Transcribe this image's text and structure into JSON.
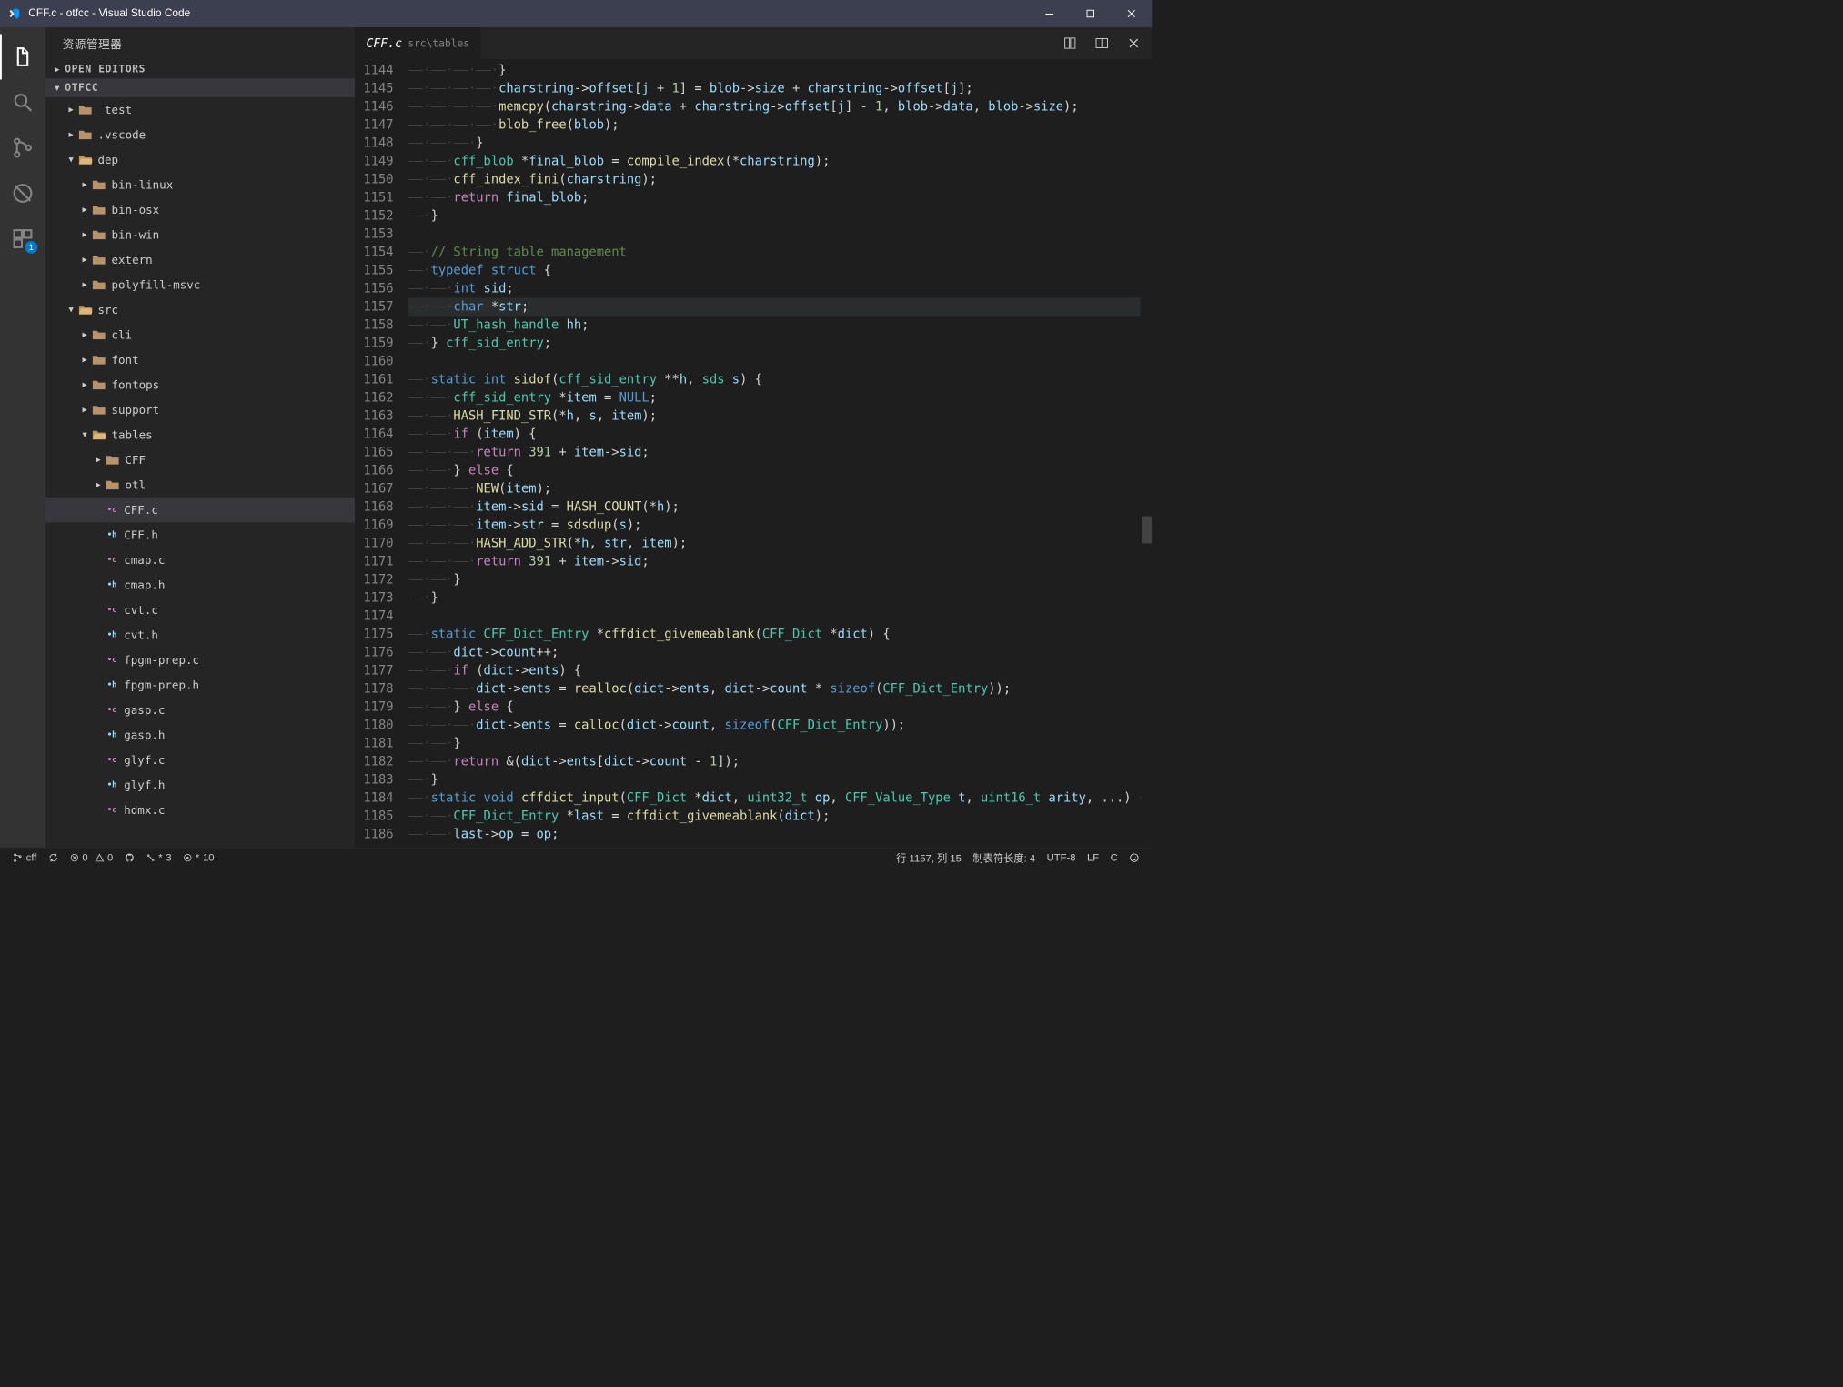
{
  "window": {
    "title": "CFF.c - otfcc - Visual Studio Code"
  },
  "sidebar": {
    "title": "资源管理器",
    "sections": {
      "openEditors": "OPEN EDITORS",
      "project": "OTFCC"
    },
    "tree": [
      {
        "depth": 0,
        "type": "folder",
        "name": "_test",
        "expanded": false
      },
      {
        "depth": 0,
        "type": "folder",
        "name": ".vscode",
        "expanded": false
      },
      {
        "depth": 0,
        "type": "folder",
        "name": "dep",
        "expanded": true
      },
      {
        "depth": 1,
        "type": "folder",
        "name": "bin-linux",
        "expanded": false
      },
      {
        "depth": 1,
        "type": "folder",
        "name": "bin-osx",
        "expanded": false
      },
      {
        "depth": 1,
        "type": "folder",
        "name": "bin-win",
        "expanded": false
      },
      {
        "depth": 1,
        "type": "folder",
        "name": "extern",
        "expanded": false
      },
      {
        "depth": 1,
        "type": "folder",
        "name": "polyfill-msvc",
        "expanded": false
      },
      {
        "depth": 0,
        "type": "folder",
        "name": "src",
        "expanded": true
      },
      {
        "depth": 1,
        "type": "folder",
        "name": "cli",
        "expanded": false
      },
      {
        "depth": 1,
        "type": "folder",
        "name": "font",
        "expanded": false
      },
      {
        "depth": 1,
        "type": "folder",
        "name": "fontops",
        "expanded": false
      },
      {
        "depth": 1,
        "type": "folder",
        "name": "support",
        "expanded": false
      },
      {
        "depth": 1,
        "type": "folder",
        "name": "tables",
        "expanded": true
      },
      {
        "depth": 2,
        "type": "folder",
        "name": "CFF",
        "expanded": false
      },
      {
        "depth": 2,
        "type": "folder",
        "name": "otl",
        "expanded": false
      },
      {
        "depth": 2,
        "type": "file",
        "ext": "c",
        "name": "CFF.c",
        "selected": true
      },
      {
        "depth": 2,
        "type": "file",
        "ext": "h",
        "name": "CFF.h"
      },
      {
        "depth": 2,
        "type": "file",
        "ext": "c",
        "name": "cmap.c"
      },
      {
        "depth": 2,
        "type": "file",
        "ext": "h",
        "name": "cmap.h"
      },
      {
        "depth": 2,
        "type": "file",
        "ext": "c",
        "name": "cvt.c"
      },
      {
        "depth": 2,
        "type": "file",
        "ext": "h",
        "name": "cvt.h"
      },
      {
        "depth": 2,
        "type": "file",
        "ext": "c",
        "name": "fpgm-prep.c"
      },
      {
        "depth": 2,
        "type": "file",
        "ext": "h",
        "name": "fpgm-prep.h"
      },
      {
        "depth": 2,
        "type": "file",
        "ext": "c",
        "name": "gasp.c"
      },
      {
        "depth": 2,
        "type": "file",
        "ext": "h",
        "name": "gasp.h"
      },
      {
        "depth": 2,
        "type": "file",
        "ext": "c",
        "name": "glyf.c"
      },
      {
        "depth": 2,
        "type": "file",
        "ext": "h",
        "name": "glyf.h"
      },
      {
        "depth": 2,
        "type": "file",
        "ext": "c",
        "name": "hdmx.c"
      }
    ]
  },
  "activity": {
    "badge": "1"
  },
  "tab": {
    "name": "CFF.c",
    "path": "src\\tables"
  },
  "code": {
    "startLine": 1144,
    "currentLine": 1157,
    "lines": [
      {
        "n": 1144,
        "html": "<span class='c-ws'>——·——·——·——·</span>}"
      },
      {
        "n": 1145,
        "html": "<span class='c-ws'>——·——·——·——·</span><span class='c-var'>charstring</span><span class='c-op'>-&gt;</span><span class='c-var'>offset</span>[<span class='c-var'>j</span> + <span class='c-num'>1</span>] = <span class='c-var'>blob</span><span class='c-op'>-&gt;</span><span class='c-var'>size</span> + <span class='c-var'>charstring</span><span class='c-op'>-&gt;</span><span class='c-var'>offset</span>[<span class='c-var'>j</span>];"
      },
      {
        "n": 1146,
        "html": "<span class='c-ws'>——·——·——·——·</span><span class='c-fn'>memcpy</span>(<span class='c-var'>charstring</span><span class='c-op'>-&gt;</span><span class='c-var'>data</span> + <span class='c-var'>charstring</span><span class='c-op'>-&gt;</span><span class='c-var'>offset</span>[<span class='c-var'>j</span>] - <span class='c-num'>1</span>, <span class='c-var'>blob</span><span class='c-op'>-&gt;</span><span class='c-var'>data</span>, <span class='c-var'>blob</span><span class='c-op'>-&gt;</span><span class='c-var'>size</span>);"
      },
      {
        "n": 1147,
        "html": "<span class='c-ws'>——·——·——·——·</span><span class='c-fn'>blob_free</span>(<span class='c-var'>blob</span>);"
      },
      {
        "n": 1148,
        "html": "<span class='c-ws'>——·——·——·</span>}"
      },
      {
        "n": 1149,
        "html": "<span class='c-ws'>——·——·</span><span class='c-type'>cff_blob</span> *<span class='c-var'>final_blob</span> = <span class='c-fn'>compile_index</span>(*<span class='c-var'>charstring</span>);"
      },
      {
        "n": 1150,
        "html": "<span class='c-ws'>——·——·</span><span class='c-fn'>cff_index_fini</span>(<span class='c-var'>charstring</span>);"
      },
      {
        "n": 1151,
        "html": "<span class='c-ws'>——·——·</span><span class='c-ctrl'>return</span> <span class='c-var'>final_blob</span>;"
      },
      {
        "n": 1152,
        "html": "<span class='c-ws'>——·</span>}"
      },
      {
        "n": 1153,
        "html": ""
      },
      {
        "n": 1154,
        "html": "<span class='c-ws'>——·</span><span class='c-cmt'>// String table management</span>"
      },
      {
        "n": 1155,
        "html": "<span class='c-ws'>——·</span><span class='c-kw'>typedef</span> <span class='c-kw'>struct</span> {"
      },
      {
        "n": 1156,
        "html": "<span class='c-ws'>——·——·</span><span class='c-kw'>int</span> <span class='c-var'>sid</span>;"
      },
      {
        "n": 1157,
        "html": "<span class='c-ws'>——·——·</span><span class='c-kw'>char</span> *<span class='c-var'>str</span>;"
      },
      {
        "n": 1158,
        "html": "<span class='c-ws'>——·——·</span><span class='c-type'>UT_hash_handle</span> <span class='c-var'>hh</span>;"
      },
      {
        "n": 1159,
        "html": "<span class='c-ws'>——·</span>} <span class='c-type'>cff_sid_entry</span>;"
      },
      {
        "n": 1160,
        "html": ""
      },
      {
        "n": 1161,
        "html": "<span class='c-ws'>——·</span><span class='c-kw'>static</span> <span class='c-kw'>int</span> <span class='c-fn'>sidof</span>(<span class='c-type'>cff_sid_entry</span> **<span class='c-var'>h</span>, <span class='c-type'>sds</span> <span class='c-var'>s</span>) {"
      },
      {
        "n": 1162,
        "html": "<span class='c-ws'>——·——·</span><span class='c-type'>cff_sid_entry</span> *<span class='c-var'>item</span> = <span class='c-kw'>NULL</span>;"
      },
      {
        "n": 1163,
        "html": "<span class='c-ws'>——·——·</span><span class='c-fn'>HASH_FIND_STR</span>(*<span class='c-var'>h</span>, <span class='c-var'>s</span>, <span class='c-var'>item</span>);"
      },
      {
        "n": 1164,
        "html": "<span class='c-ws'>——·——·</span><span class='c-ctrl'>if</span> (<span class='c-var'>item</span>) {"
      },
      {
        "n": 1165,
        "html": "<span class='c-ws'>——·——·——·</span><span class='c-ctrl'>return</span> <span class='c-num'>391</span> + <span class='c-var'>item</span><span class='c-op'>-&gt;</span><span class='c-var'>sid</span>;"
      },
      {
        "n": 1166,
        "html": "<span class='c-ws'>——·——·</span>} <span class='c-ctrl'>else</span> {"
      },
      {
        "n": 1167,
        "html": "<span class='c-ws'>——·——·——·</span><span class='c-fn'>NEW</span>(<span class='c-var'>item</span>);"
      },
      {
        "n": 1168,
        "html": "<span class='c-ws'>——·——·——·</span><span class='c-var'>item</span><span class='c-op'>-&gt;</span><span class='c-var'>sid</span> = <span class='c-fn'>HASH_COUNT</span>(*<span class='c-var'>h</span>);"
      },
      {
        "n": 1169,
        "html": "<span class='c-ws'>——·——·——·</span><span class='c-var'>item</span><span class='c-op'>-&gt;</span><span class='c-var'>str</span> = <span class='c-fn'>sdsdup</span>(<span class='c-var'>s</span>);"
      },
      {
        "n": 1170,
        "html": "<span class='c-ws'>——·——·——·</span><span class='c-fn'>HASH_ADD_STR</span>(*<span class='c-var'>h</span>, <span class='c-var'>str</span>, <span class='c-var'>item</span>);"
      },
      {
        "n": 1171,
        "html": "<span class='c-ws'>——·——·——·</span><span class='c-ctrl'>return</span> <span class='c-num'>391</span> + <span class='c-var'>item</span><span class='c-op'>-&gt;</span><span class='c-var'>sid</span>;"
      },
      {
        "n": 1172,
        "html": "<span class='c-ws'>——·——·</span>}"
      },
      {
        "n": 1173,
        "html": "<span class='c-ws'>——·</span>}"
      },
      {
        "n": 1174,
        "html": ""
      },
      {
        "n": 1175,
        "html": "<span class='c-ws'>——·</span><span class='c-kw'>static</span> <span class='c-type'>CFF_Dict_Entry</span> *<span class='c-fn'>cffdict_givemeablank</span>(<span class='c-type'>CFF_Dict</span> *<span class='c-var'>dict</span>) {"
      },
      {
        "n": 1176,
        "html": "<span class='c-ws'>——·——·</span><span class='c-var'>dict</span><span class='c-op'>-&gt;</span><span class='c-var'>count</span>++;"
      },
      {
        "n": 1177,
        "html": "<span class='c-ws'>——·——·</span><span class='c-ctrl'>if</span> (<span class='c-var'>dict</span><span class='c-op'>-&gt;</span><span class='c-var'>ents</span>) {"
      },
      {
        "n": 1178,
        "html": "<span class='c-ws'>——·——·——·</span><span class='c-var'>dict</span><span class='c-op'>-&gt;</span><span class='c-var'>ents</span> = <span class='c-fn'>realloc</span>(<span class='c-var'>dict</span><span class='c-op'>-&gt;</span><span class='c-var'>ents</span>, <span class='c-var'>dict</span><span class='c-op'>-&gt;</span><span class='c-var'>count</span> * <span class='c-kw'>sizeof</span>(<span class='c-type'>CFF_Dict_Entry</span>));"
      },
      {
        "n": 1179,
        "html": "<span class='c-ws'>——·——·</span>} <span class='c-ctrl'>else</span> {"
      },
      {
        "n": 1180,
        "html": "<span class='c-ws'>——·——·——·</span><span class='c-var'>dict</span><span class='c-op'>-&gt;</span><span class='c-var'>ents</span> = <span class='c-fn'>calloc</span>(<span class='c-var'>dict</span><span class='c-op'>-&gt;</span><span class='c-var'>count</span>, <span class='c-kw'>sizeof</span>(<span class='c-type'>CFF_Dict_Entry</span>));"
      },
      {
        "n": 1181,
        "html": "<span class='c-ws'>——·——·</span>}"
      },
      {
        "n": 1182,
        "html": "<span class='c-ws'>——·——·</span><span class='c-ctrl'>return</span> &amp;(<span class='c-var'>dict</span><span class='c-op'>-&gt;</span><span class='c-var'>ents</span>[<span class='c-var'>dict</span><span class='c-op'>-&gt;</span><span class='c-var'>count</span> - <span class='c-num'>1</span>]);"
      },
      {
        "n": 1183,
        "html": "<span class='c-ws'>——·</span>}"
      },
      {
        "n": 1184,
        "html": "<span class='c-ws'>——·</span><span class='c-kw'>static</span> <span class='c-kw'>void</span> <span class='c-fn'>cffdict_input</span>(<span class='c-type'>CFF_Dict</span> *<span class='c-var'>dict</span>, <span class='c-type'>uint32_t</span> <span class='c-var'>op</span>, <span class='c-type'>CFF_Value_Type</span> <span class='c-var'>t</span>, <span class='c-type'>uint16_t</span> <span class='c-var'>arity</span>, ...) {"
      },
      {
        "n": 1185,
        "html": "<span class='c-ws'>——·——·</span><span class='c-type'>CFF_Dict_Entry</span> *<span class='c-var'>last</span> = <span class='c-fn'>cffdict_givemeablank</span>(<span class='c-var'>dict</span>);"
      },
      {
        "n": 1186,
        "html": "<span class='c-ws'>——·——·</span><span class='c-var'>last</span><span class='c-op'>-&gt;</span><span class='c-var'>op</span> = <span class='c-var'>op</span>;"
      }
    ]
  },
  "status": {
    "branch": "cff",
    "errors": "0",
    "warnings": "0",
    "gitStar": "3",
    "gitInfo": "10",
    "position": "行 1157, 列 15",
    "tabSize": "制表符长度: 4",
    "encoding": "UTF-8",
    "eol": "LF",
    "lang": "C"
  }
}
